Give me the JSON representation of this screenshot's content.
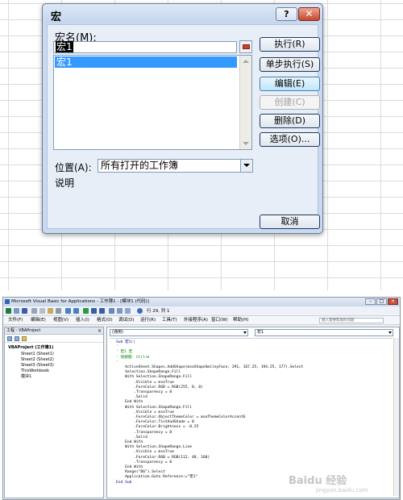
{
  "dialog": {
    "title": "宏",
    "help_glyph": "?",
    "close_glyph": "✕",
    "macro_name_label": "宏名(M):",
    "macro_name_value": "宏1",
    "macro_list": [
      "宏1"
    ],
    "buttons": {
      "run": "执行(R)",
      "step_into": "单步执行(S)",
      "edit": "编辑(E)",
      "create": "创建(C)",
      "delete": "删除(D)",
      "options": "选项(O)...",
      "cancel": "取消"
    },
    "location_label": "位置(A):",
    "location_value": "所有打开的工作簿",
    "description_label": "说明"
  },
  "vba": {
    "title": "Microsoft Visual Basic for Applications - 工作簿1 - [模块1 (代码)]",
    "cursor_position": "行 29, 列 1",
    "menu": [
      "文件(F)",
      "编辑(E)",
      "视图(V)",
      "插入(I)",
      "格式(O)",
      "调试(D)",
      "运行(R)",
      "工具(T)",
      "外接程序(A)",
      "窗口(W)",
      "帮助(H)"
    ],
    "help_search_placeholder": "键入需要帮助的问题",
    "project_pane_title": "工程 - VBAProject",
    "project_tree": [
      "VBAProject (工作簿1)",
      "Sheet1 (Sheet1)",
      "Sheet2 (Sheet2)",
      "Sheet3 (Sheet3)",
      "ThisWorkbook",
      "模块1"
    ],
    "object_combo": "(通用)",
    "procedure_combo": "宏1",
    "code_lines": [
      "Sub 宏1()",
      "'",
      "' 宏1 宏",
      "' 快捷键: Ctrl+k",
      "'",
      "    ActiveSheet.Shapes.AddShape(msoShapeSmileyFace, 291, 167.25, 194.25, 177).Select",
      "    Selection.ShapeRange.Fill",
      "    With Selection.ShapeRange.Fill",
      "        .Visible = msoTrue",
      "        .ForeColor.RGB = RGB(255, 0, 0)",
      "        .Transparency = 0",
      "        .Solid",
      "    End With",
      "    With Selection.ShapeRange.Fill",
      "        .Visible = msoTrue",
      "        .ForeColor.ObjectThemeColor = msoThemeColorAccent6",
      "        .ForeColor.TintAndShade = 0",
      "        .ForeColor.Brightness = -0.25",
      "        .Transparency = 0",
      "        .Solid",
      "    End With",
      "    With Selection.ShapeRange.Line",
      "        .Visible = msoTrue",
      "        .ForeColor.RGB = RGB(112, 48, 160)",
      "        .Transparency = 0",
      "    End With",
      "    Range(\"B6\").Select",
      "    Application.Goto Reference:=\"宏1\"",
      "End Sub"
    ]
  },
  "watermark": {
    "text": "Baidu 经验",
    "url": "jingyan.baidu.com"
  },
  "colors": {
    "dialog_frame": "#c9daf0",
    "selection": "#3399ff",
    "close_button": "#c6452c",
    "code_keyword": "#00008b",
    "code_comment": "#008000"
  }
}
